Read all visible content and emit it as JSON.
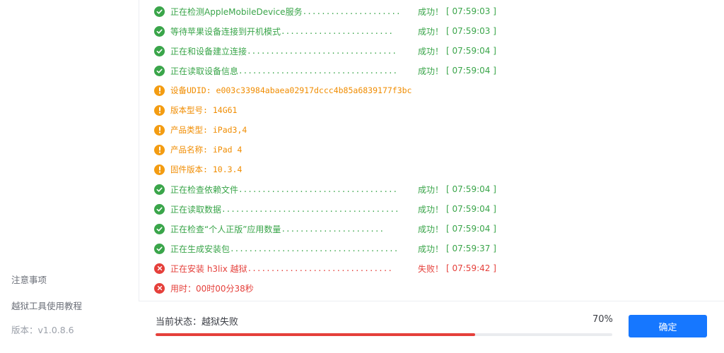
{
  "sidebar": {
    "links": [
      "注意事项",
      "越狱工具使用教程"
    ],
    "version": "版本：v1.0.8.6"
  },
  "log": [
    {
      "status": "success",
      "text": "正在检测AppleMobileDevice服务",
      "dots": ".....................",
      "result": "成功！",
      "time": "[ 07:59:03 ]"
    },
    {
      "status": "success",
      "text": "等待苹果设备连接到开机模式",
      "dots": "........................",
      "result": "成功！",
      "time": "[ 07:59:03 ]"
    },
    {
      "status": "success",
      "text": "正在和设备建立连接",
      "dots": "................................",
      "result": "成功！",
      "time": "[ 07:59:04 ]"
    },
    {
      "status": "success",
      "text": "正在读取设备信息",
      "dots": "..................................",
      "result": "成功！",
      "time": "[ 07:59:04 ]"
    },
    {
      "status": "info",
      "text": "设备UDID: e003c33984abaea02917dccc4b85a6839177f3bc",
      "dots": "",
      "result": "",
      "time": ""
    },
    {
      "status": "info",
      "text": "版本型号: 14G61",
      "dots": "",
      "result": "",
      "time": ""
    },
    {
      "status": "info",
      "text": "产品类型: iPad3,4",
      "dots": "",
      "result": "",
      "time": ""
    },
    {
      "status": "info",
      "text": "产品名称: iPad 4",
      "dots": "",
      "result": "",
      "time": ""
    },
    {
      "status": "info",
      "text": "固件版本: 10.3.4",
      "dots": "",
      "result": "",
      "time": ""
    },
    {
      "status": "success",
      "text": "正在检查依赖文件",
      "dots": "..................................",
      "result": "成功！",
      "time": "[ 07:59:04 ]"
    },
    {
      "status": "success",
      "text": "正在读取数据",
      "dots": "......................................",
      "result": "成功！",
      "time": "[ 07:59:04 ]"
    },
    {
      "status": "success",
      "text": "正在检查“个人正版”应用数量",
      "dots": "......................",
      "result": "成功！",
      "time": "[ 07:59:04 ]"
    },
    {
      "status": "success",
      "text": "正在生成安装包",
      "dots": "....................................",
      "result": "成功！",
      "time": "[ 07:59:37 ]"
    },
    {
      "status": "error",
      "text": "正在安装 h3lix 越狱",
      "dots": "...............................",
      "result": "失败！",
      "time": "[ 07:59:42 ]"
    },
    {
      "status": "error",
      "text": "用时：00时00分38秒",
      "dots": "",
      "result": "",
      "time": ""
    }
  ],
  "footer": {
    "status_label": "当前状态：越狱失败",
    "percent_label": "70%",
    "progress": 0.7,
    "confirm_label": "确定"
  },
  "colors": {
    "success": "#3aa54a",
    "info": "#f08c00",
    "error": "#e5403b",
    "progress_fill": "#e5403b",
    "button": "#1677ff"
  }
}
